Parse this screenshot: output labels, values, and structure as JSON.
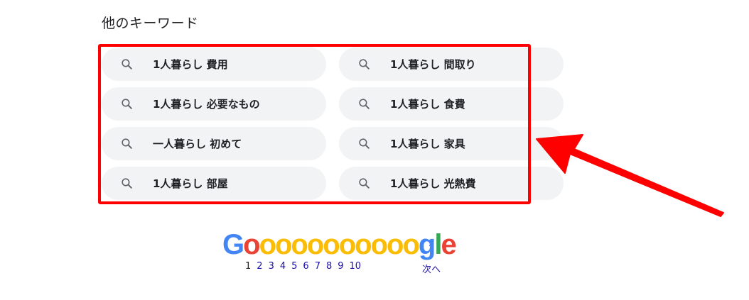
{
  "section": {
    "heading": "他のキーワード"
  },
  "keywords": [
    {
      "label": "1人暮らし 費用"
    },
    {
      "label": "1人暮らし 間取り"
    },
    {
      "label": "1人暮らし 必要なもの"
    },
    {
      "label": "1人暮らし 食費"
    },
    {
      "label": "一人暮らし 初めて"
    },
    {
      "label": "1人暮らし 家具"
    },
    {
      "label": "1人暮らし 部屋"
    },
    {
      "label": "1人暮らし 光熱費"
    }
  ],
  "icons": {
    "chip_icon": "search-icon",
    "next_icon": "chevron-right-icon"
  },
  "pagination": {
    "logo": {
      "G": "G",
      "o_first": "o",
      "o_rest": "oooooooooo",
      "g": "g",
      "l": "l",
      "e": "e"
    },
    "pages": [
      "1",
      "2",
      "3",
      "4",
      "5",
      "6",
      "7",
      "8",
      "9",
      "10"
    ],
    "current_page": "1",
    "next_label": "次へ",
    "next_chevron": "›"
  },
  "colors": {
    "highlight": "#ff0000",
    "chip_bg": "#f1f3f4",
    "link": "#1a0dab",
    "google_blue": "#4285f4",
    "google_red": "#ea4335",
    "google_yellow": "#fbbc05",
    "google_green": "#34a853"
  }
}
